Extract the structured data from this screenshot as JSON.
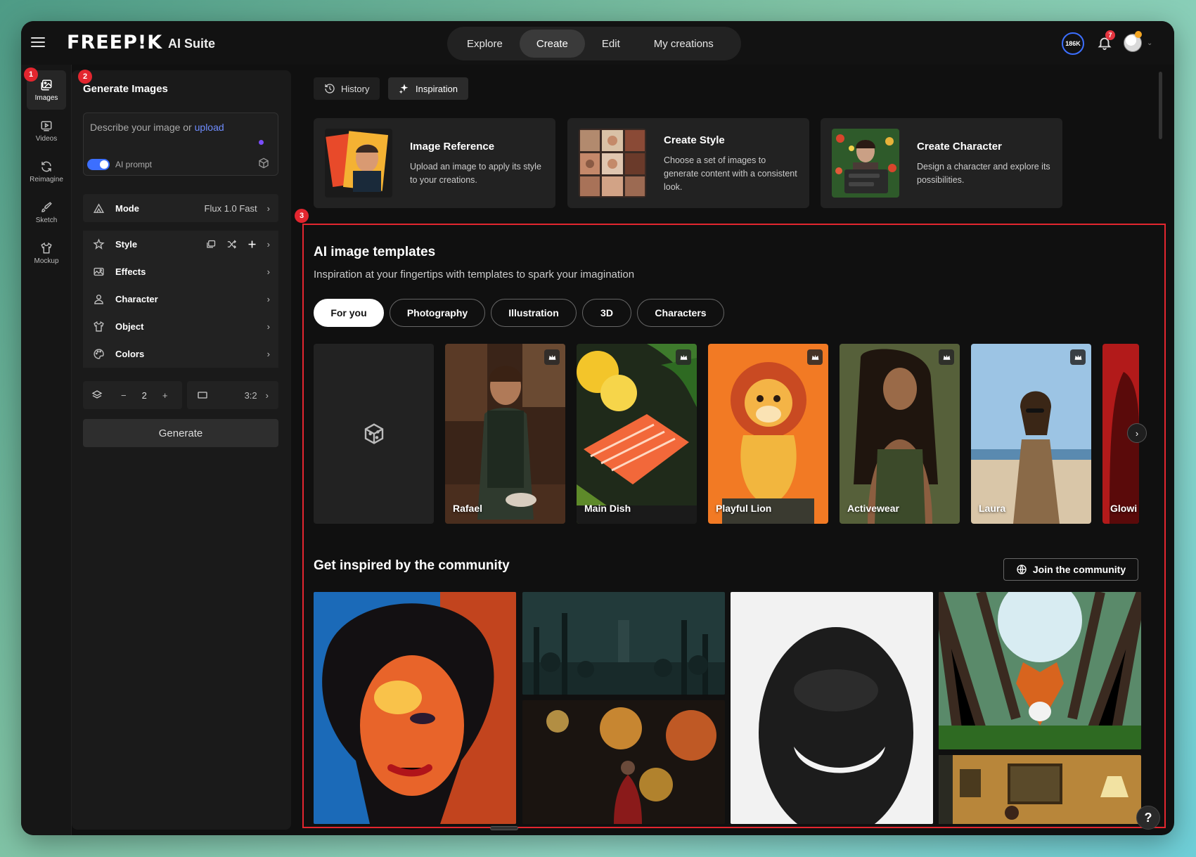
{
  "app": {
    "logo": "FREEP!K",
    "suite": "AI Suite"
  },
  "nav": [
    {
      "label": "Explore"
    },
    {
      "label": "Create",
      "active": true
    },
    {
      "label": "Edit"
    },
    {
      "label": "My creations"
    }
  ],
  "header": {
    "credits": "186K",
    "notifications": "7"
  },
  "rail": [
    {
      "label": "Images",
      "icon": "image-icon",
      "active": true
    },
    {
      "label": "Videos",
      "icon": "video-icon"
    },
    {
      "label": "Reimagine",
      "icon": "refresh-icon"
    },
    {
      "label": "Sketch",
      "icon": "brush-icon"
    },
    {
      "label": "Mockup",
      "icon": "shirt-icon"
    }
  ],
  "markers": [
    "1",
    "2",
    "3"
  ],
  "panel": {
    "title": "Generate Images",
    "prompt_placeholder": "Describe your image or ",
    "prompt_link": "upload",
    "ai_prompt_label": "AI prompt",
    "mode_label": "Mode",
    "mode_value": "Flux 1.0 Fast",
    "style_label": "Style",
    "effects_label": "Effects",
    "character_label": "Character",
    "object_label": "Object",
    "colors_label": "Colors",
    "quantity": "2",
    "minus": "−",
    "plus": "+",
    "aspect_ratio": "3:2",
    "generate_label": "Generate"
  },
  "tabs": [
    {
      "label": "History",
      "icon": "history-icon"
    },
    {
      "label": "Inspiration",
      "icon": "sparkle-icon",
      "active": true
    }
  ],
  "cards": [
    {
      "title": "Image Reference",
      "desc": "Upload an image to apply its style to your creations."
    },
    {
      "title": "Create Style",
      "desc": "Choose a set of images to generate content with a consistent look."
    },
    {
      "title": "Create Character",
      "desc": "Design a character and explore its possibilities."
    }
  ],
  "templates": {
    "title": "AI image templates",
    "subtitle": "Inspiration at your fingertips with templates to spark your imagination",
    "filters": [
      "For you",
      "Photography",
      "Illustration",
      "3D",
      "Characters"
    ],
    "items": [
      {
        "label": "Rafael"
      },
      {
        "label": "Main Dish"
      },
      {
        "label": "Playful Lion"
      },
      {
        "label": "Activewear"
      },
      {
        "label": "Laura"
      },
      {
        "label": "Glowi"
      }
    ]
  },
  "community": {
    "title": "Get inspired by the community",
    "join_label": "Join the community"
  },
  "help": "?",
  "colors": {
    "accent": "#3c6fff",
    "marker": "#e3262f",
    "background": "#101010"
  }
}
